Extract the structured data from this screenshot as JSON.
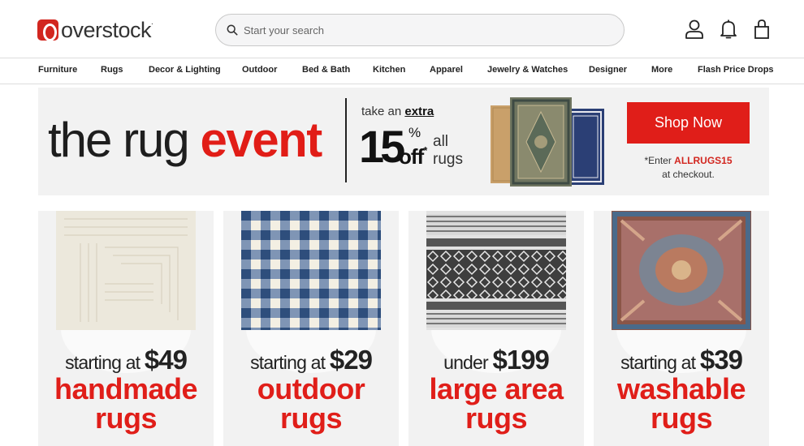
{
  "header": {
    "logo_text": "overstock",
    "logo_suffix": ".",
    "search_placeholder": "Start your search",
    "icons": [
      "account-icon",
      "notifications-bell-icon",
      "cart-bag-icon"
    ]
  },
  "nav": {
    "items": [
      "Furniture",
      "Rugs",
      "Decor & Lighting",
      "Outdoor",
      "Bed & Bath",
      "Kitchen",
      "Apparel",
      "Jewelry & Watches",
      "Designer",
      "More",
      "Flash Price Drops"
    ]
  },
  "banner": {
    "title_start": "the rug ",
    "title_emph": "event",
    "promo_lead": "take an ",
    "promo_lead_bold": "extra",
    "promo_number": "15",
    "promo_percent": "%",
    "promo_off": "off",
    "promo_asterisk": "*",
    "promo_all": "all",
    "promo_rugs": "rugs",
    "cta_label": "Shop Now",
    "code_prefix": "*Enter ",
    "code": "ALLRUGS15",
    "code_suffix": "at checkout."
  },
  "cards": [
    {
      "price_prefix": "starting at ",
      "price": "$49",
      "line1": "handmade",
      "line2": "rugs"
    },
    {
      "price_prefix": "starting at ",
      "price": "$29",
      "line1": "outdoor",
      "line2": "rugs"
    },
    {
      "price_prefix": "under ",
      "price": "$199",
      "line1": "large area",
      "line2": "rugs"
    },
    {
      "price_prefix": "starting at ",
      "price": "$39",
      "line1": "washable",
      "line2": "rugs"
    }
  ],
  "colors": {
    "brand_red": "#e01e19",
    "background_gray": "#f2f2f2"
  }
}
